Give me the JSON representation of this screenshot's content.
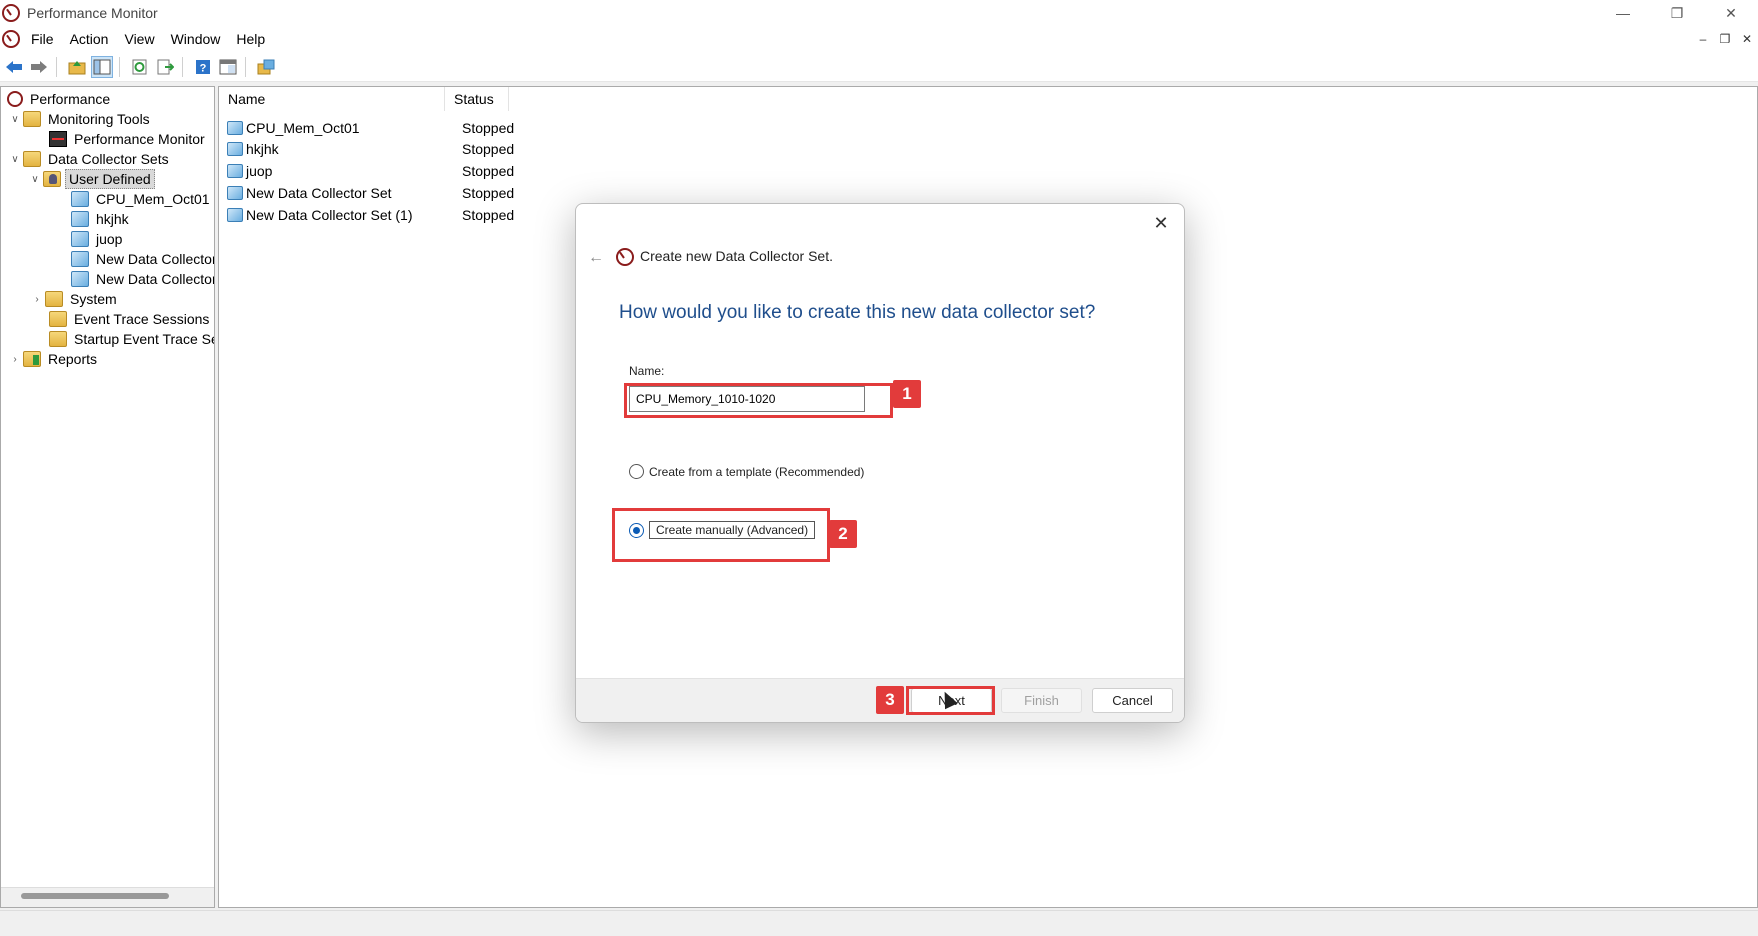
{
  "window": {
    "title": "Performance Monitor"
  },
  "menu": [
    "File",
    "Action",
    "View",
    "Window",
    "Help"
  ],
  "tree": {
    "root": "Performance",
    "monitoring_tools": "Monitoring Tools",
    "performance_monitor": "Performance Monitor",
    "data_collector_sets": "Data Collector Sets",
    "user_defined": "User Defined",
    "children": [
      "CPU_Mem_Oct01",
      "hkjhk",
      "juop",
      "New Data Collector",
      "New Data Collector"
    ],
    "system": "System",
    "event_trace": "Event Trace Sessions",
    "startup_trace": "Startup Event Trace Sess",
    "reports": "Reports"
  },
  "list": {
    "columns": {
      "name": "Name",
      "status": "Status"
    },
    "rows": [
      {
        "name": "CPU_Mem_Oct01",
        "status": "Stopped"
      },
      {
        "name": "hkjhk",
        "status": "Stopped"
      },
      {
        "name": "juop",
        "status": "Stopped"
      },
      {
        "name": "New Data Collector Set",
        "status": "Stopped"
      },
      {
        "name": "New Data Collector Set (1)",
        "status": "Stopped"
      }
    ]
  },
  "dialog": {
    "title": "Create new Data Collector Set.",
    "heading": "How would you like to create this new data collector set?",
    "name_label": "Name:",
    "name_value": "CPU_Memory_1010-1020",
    "option_template": "Create from a template (Recommended)",
    "option_manual": "Create manually (Advanced)",
    "btn_next": "Next",
    "btn_finish": "Finish",
    "btn_cancel": "Cancel"
  },
  "annotations": {
    "b1": "1",
    "b2": "2",
    "b3": "3",
    "color": "#e23b3b"
  }
}
